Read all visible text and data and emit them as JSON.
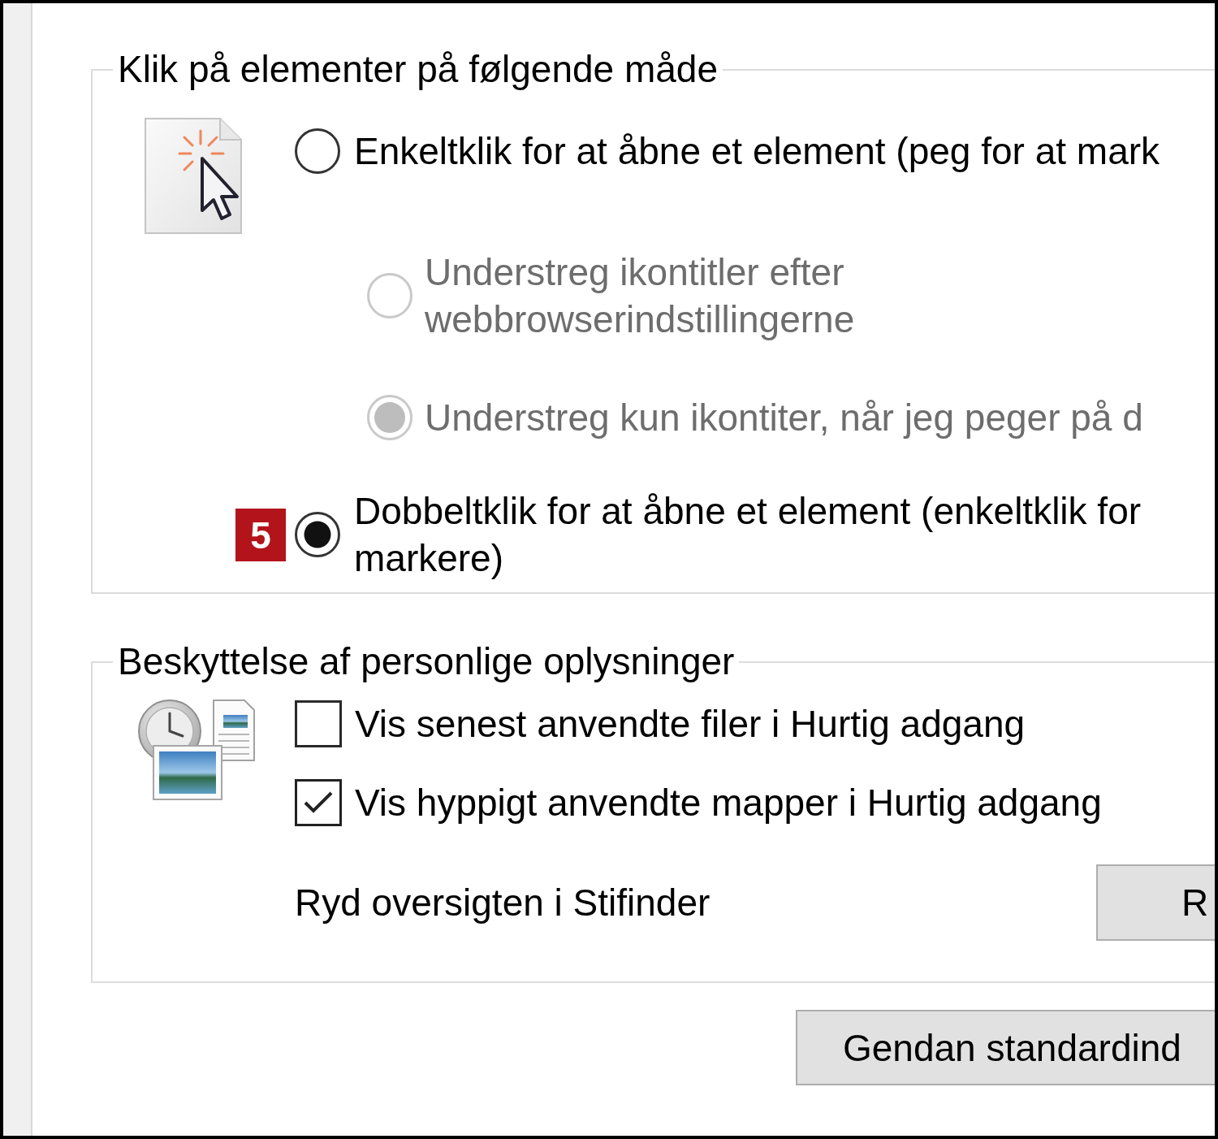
{
  "click_group": {
    "title": "Klik på elementer på følgende måde",
    "options": [
      {
        "lines": [
          "Enkeltklik for at åbne et element (peg for at mark"
        ],
        "selected": false,
        "disabled": false,
        "children": [
          {
            "lines": [
              "Understreg ikontitler efter",
              "webbrowserindstillingerne"
            ],
            "selected": false,
            "disabled": true
          },
          {
            "lines": [
              "Understreg kun ikontiter, når jeg peger på d"
            ],
            "selected": true,
            "disabled": true
          }
        ]
      },
      {
        "badge": "5",
        "lines": [
          "Dobbeltklik for at åbne et element (enkeltklik for",
          "markere)"
        ],
        "selected": true,
        "disabled": false
      }
    ]
  },
  "privacy_group": {
    "title": "Beskyttelse af personlige oplysninger",
    "checkboxes": [
      {
        "label": "Vis senest anvendte filer i Hurtig adgang",
        "checked": false
      },
      {
        "label": "Vis hyppigt anvendte mapper i Hurtig adgang",
        "checked": true
      }
    ],
    "clear_history": {
      "label": "Ryd oversigten i Stifinder",
      "button": "R"
    }
  },
  "restore_button": "Gendan standardind"
}
